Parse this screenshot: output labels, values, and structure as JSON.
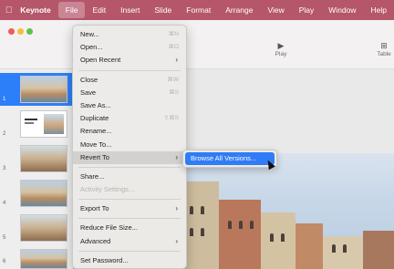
{
  "menubar": {
    "app_name": "Keynote",
    "items": [
      "File",
      "Edit",
      "Insert",
      "Slide",
      "Format",
      "Arrange",
      "View",
      "Play",
      "Window",
      "Help"
    ]
  },
  "toolbar": {
    "play_label": "Play",
    "table_label": "Table"
  },
  "navigator": {
    "slides": [
      "1",
      "2",
      "3",
      "4",
      "5",
      "6"
    ]
  },
  "file_menu": {
    "items": [
      {
        "label": "New...",
        "shortcut": "⌘N"
      },
      {
        "label": "Open...",
        "shortcut": "⌘O"
      },
      {
        "label": "Open Recent",
        "shortcut": "›"
      },
      {
        "label": "Close",
        "shortcut": "⌘W"
      },
      {
        "label": "Save",
        "shortcut": "⌘S"
      },
      {
        "label": "Save As...",
        "shortcut": ""
      },
      {
        "label": "Duplicate",
        "shortcut": "⇧⌘S"
      },
      {
        "label": "Rename...",
        "shortcut": ""
      },
      {
        "label": "Move To...",
        "shortcut": ""
      },
      {
        "label": "Revert To",
        "shortcut": "›"
      },
      {
        "label": "Share...",
        "shortcut": ""
      },
      {
        "label": "Activity Settings...",
        "shortcut": ""
      },
      {
        "label": "Export To",
        "shortcut": "›"
      },
      {
        "label": "Reduce File Size...",
        "shortcut": ""
      },
      {
        "label": "Advanced",
        "shortcut": "›"
      },
      {
        "label": "Set Password...",
        "shortcut": ""
      }
    ]
  },
  "submenu": {
    "browse_label": "Browse All Versions..."
  },
  "colors": {
    "menubar_bg": "#b5566b",
    "highlight": "#2f7cf6"
  }
}
